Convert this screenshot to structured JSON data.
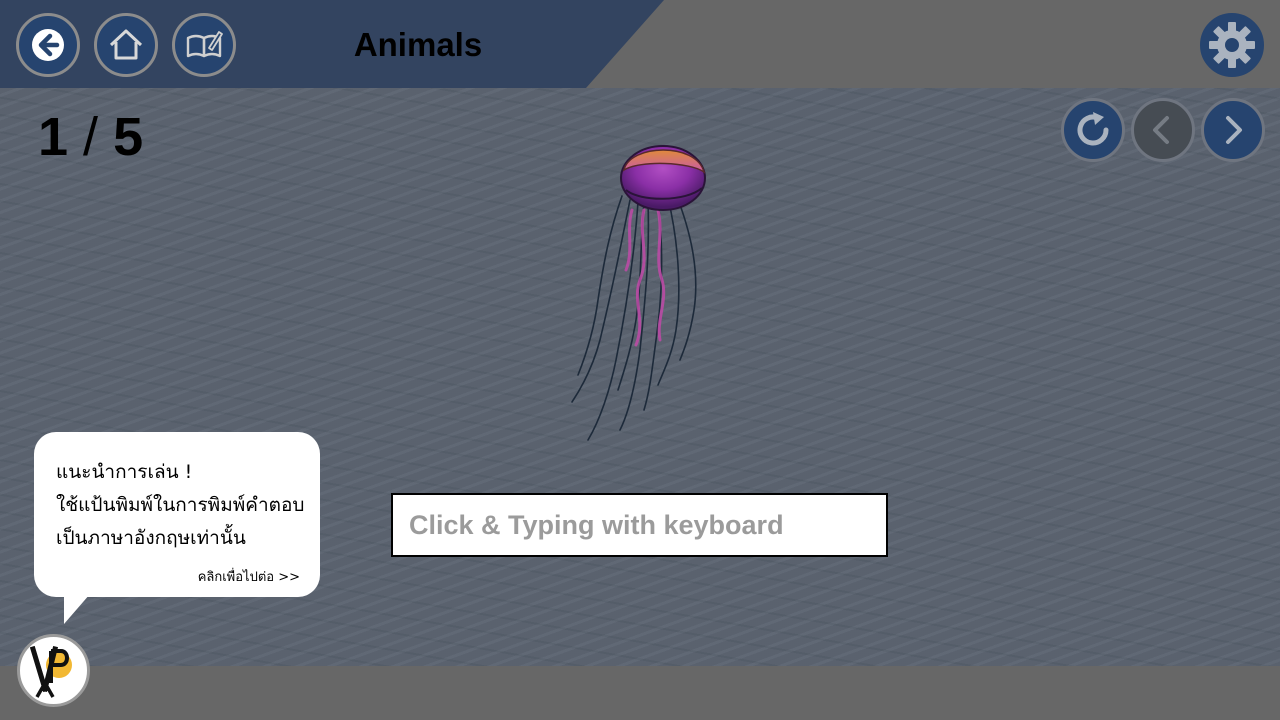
{
  "header": {
    "title": "Animals",
    "back_icon": "arrow-left-icon",
    "home_icon": "home-icon",
    "book_icon": "book-edit-icon",
    "settings_icon": "gear-icon"
  },
  "progress": {
    "current": "1",
    "separator": "/",
    "total": "5"
  },
  "controls": {
    "replay_icon": "replay-icon",
    "prev_icon": "chevron-left-icon",
    "next_icon": "chevron-right-icon"
  },
  "question": {
    "image": "jellyfish",
    "answer_placeholder": "Click & Typing with keyboard",
    "answer_value": ""
  },
  "hint": {
    "line1": "แนะนำการเล่น !",
    "line2": "ใช้แป้นพิมพ์ในการพิมพ์คำตอบ",
    "line3": "เป็นภาษาอังกฤษเท่านั้น",
    "more": "คลิกเพื่อไปต่อ >>"
  },
  "colors": {
    "header_blue": "#334460",
    "button_blue": "#26446f",
    "background": "#5a6370",
    "bar_gray": "#676767"
  }
}
